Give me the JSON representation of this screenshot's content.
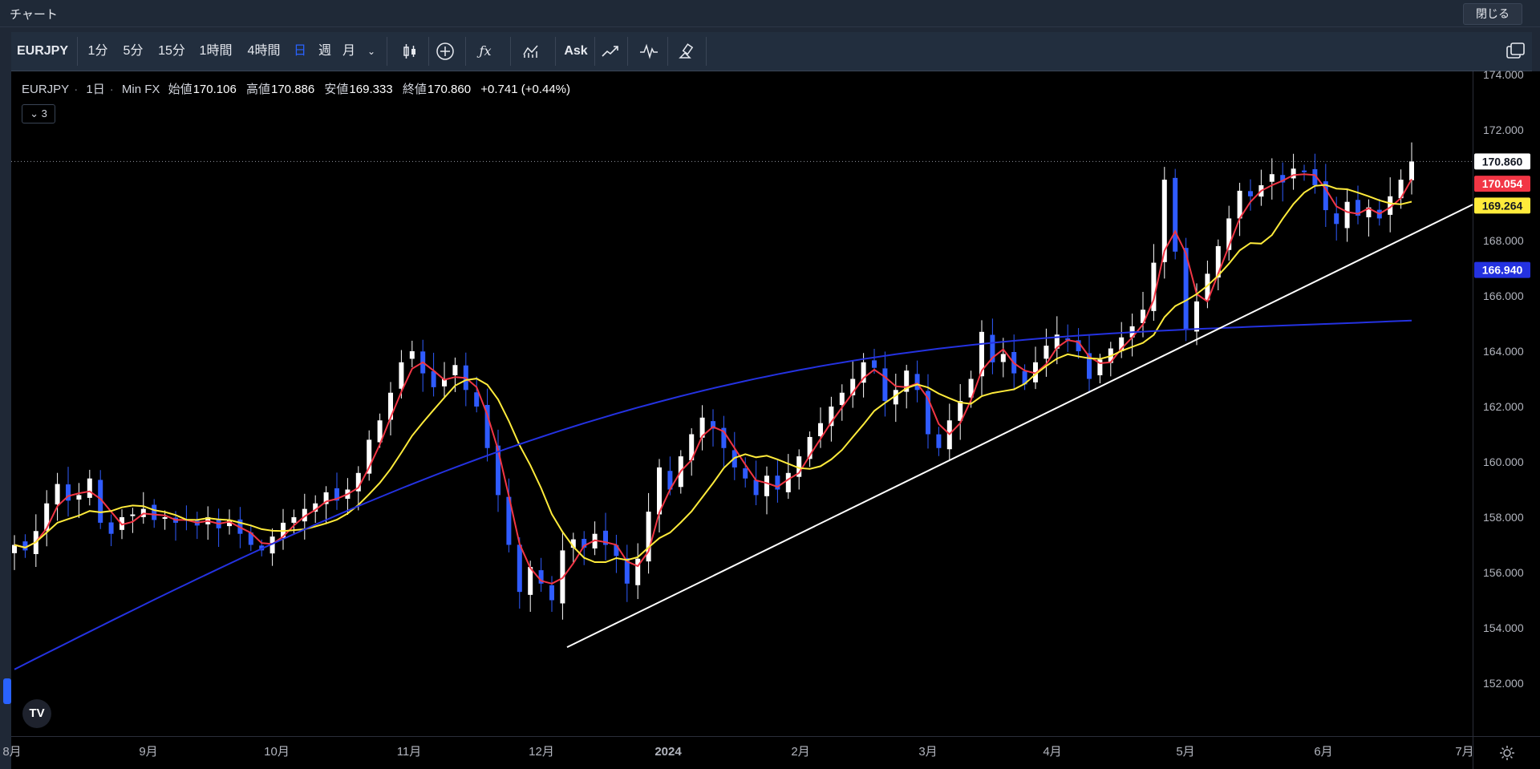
{
  "window": {
    "title": "チャート",
    "close_label": "閉じる"
  },
  "toolbar": {
    "symbol": "EURJPY",
    "intervals": [
      "1分",
      "5分",
      "15分",
      "1時間",
      "4時間",
      "日",
      "週",
      "月"
    ],
    "active_interval": "日",
    "ask_label": "Ask",
    "accent_color": "#2962ff"
  },
  "legend": {
    "symbol": "EURJPY",
    "interval": "1日",
    "source": "Min FX",
    "open_label": "始値",
    "open": "170.106",
    "high_label": "高値",
    "high": "170.886",
    "low_label": "安値",
    "low": "169.333",
    "close_label": "終値",
    "close": "170.860",
    "change": "+0.741 (+0.44%)",
    "indicators_count": "3"
  },
  "chart_data": {
    "type": "candlestick",
    "price_ticks": [
      "174.000",
      "172.000",
      "170.000",
      "168.000",
      "166.000",
      "164.000",
      "162.000",
      "160.000",
      "158.000",
      "156.000",
      "154.000",
      "152.000"
    ],
    "time_ticks": [
      "8月",
      "9月",
      "10月",
      "11月",
      "12月",
      "2024",
      "2月",
      "3月",
      "4月",
      "5月",
      "6月",
      "7月"
    ],
    "ylim": [
      151.0,
      174.5
    ],
    "current_price": "170.860",
    "ma_fast": {
      "value": "170.054",
      "color": "#f23645"
    },
    "ma_mid": {
      "value": "169.264",
      "color": "#ffeb3b"
    },
    "ma_slow": {
      "value": "166.940",
      "color": "#2432e0"
    },
    "trendline": {
      "from_price": 153.3,
      "to_price": 168.4
    },
    "series_close_path": [
      157.0,
      156.8,
      157.5,
      158.5,
      159.2,
      158.6,
      158.8,
      159.4,
      157.8,
      157.4,
      158.0,
      158.1,
      158.3,
      157.9,
      158.0,
      157.8,
      157.9,
      157.7,
      158.0,
      157.6,
      157.9,
      157.4,
      157.0,
      156.8,
      157.3,
      157.8,
      158.0,
      158.3,
      158.5,
      158.9,
      158.6,
      159.0,
      159.6,
      160.8,
      161.5,
      162.5,
      163.6,
      164.0,
      163.2,
      162.7,
      163.0,
      163.5,
      162.6,
      162.0,
      160.5,
      158.8,
      157.0,
      155.3,
      156.2,
      155.6,
      155.0,
      156.8,
      157.2,
      156.9,
      157.4,
      157.0,
      156.6,
      155.6,
      156.5,
      158.2,
      159.8,
      159.0,
      160.2,
      161.0,
      161.6,
      161.2,
      160.5,
      159.8,
      159.4,
      158.8,
      159.5,
      159.0,
      159.6,
      160.2,
      160.9,
      161.4,
      162.0,
      162.5,
      163.0,
      163.6,
      163.4,
      162.2,
      162.6,
      163.3,
      162.6,
      161.0,
      160.5,
      161.5,
      162.2,
      163.0,
      164.7,
      163.6,
      163.9,
      163.2,
      162.8,
      163.6,
      164.2,
      164.6,
      164.4,
      164.0,
      163.0,
      163.7,
      164.1,
      164.5,
      164.9,
      165.5,
      167.2,
      170.2,
      167.6,
      164.8,
      165.8,
      166.8,
      167.8,
      168.8,
      169.8,
      169.6,
      170.0,
      170.4,
      170.1,
      170.6,
      170.5,
      170.0,
      169.1,
      168.6,
      169.4,
      168.9,
      169.2,
      168.8,
      169.6,
      170.2,
      170.86
    ]
  }
}
